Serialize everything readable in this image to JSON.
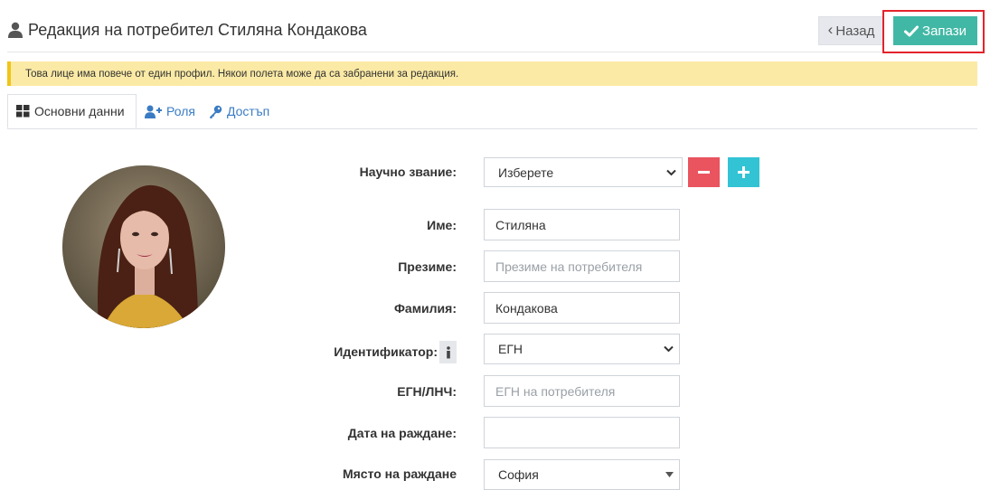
{
  "header": {
    "title": "Редакция на потребител Стиляна Кондакова"
  },
  "actions": {
    "back_label": "Назад",
    "save_label": "Запази"
  },
  "alert": {
    "text": "Това лице има повече от един профил. Някои полета може да са забранени за редакция."
  },
  "tabs": [
    {
      "label": "Основни данни",
      "icon": "grid-icon",
      "active": true
    },
    {
      "label": "Роля",
      "icon": "user-plus-icon",
      "active": false
    },
    {
      "label": "Достъп",
      "icon": "key-icon",
      "active": false
    }
  ],
  "form": {
    "academic_title": {
      "label": "Научно звание:",
      "value": "Изберете"
    },
    "first_name": {
      "label": "Име:",
      "value": "Стиляна"
    },
    "middle_name": {
      "label": "Презиме:",
      "placeholder": "Презиме на потребителя"
    },
    "last_name": {
      "label": "Фамилия:",
      "value": "Кондакова"
    },
    "identifier": {
      "label": "Идентификатор:",
      "value": "ЕГН"
    },
    "egn": {
      "label": "ЕГН/ЛНЧ:",
      "placeholder": "ЕГН на потребителя"
    },
    "birth_date": {
      "label": "Дата на раждане:",
      "value": ""
    },
    "birth_place": {
      "label": "Място на раждане",
      "value": "София"
    }
  },
  "colors": {
    "save": "#41b8a5",
    "minus": "#e9545f",
    "plus": "#32c3d4",
    "alert_bg": "#fbeaa5",
    "link": "#3a7cc4"
  }
}
